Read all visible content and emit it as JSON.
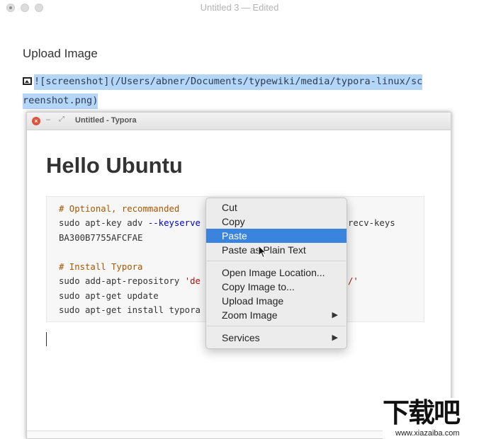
{
  "window": {
    "title": "Untitled 3",
    "title_separator": "—",
    "title_status": "Edited"
  },
  "document": {
    "heading": "Upload Image",
    "markdown_line1": "![screenshot](/Users/abner/Documents/typewiki/media/typora-linux/sc",
    "markdown_line2": "reenshot.png)"
  },
  "screenshot": {
    "window_title": "Untitled - Typora",
    "heading": "Hello Ubuntu",
    "code": {
      "line1": "# Optional, recommanded",
      "line2_a": "sudo apt-key adv ",
      "line2_b": "--keyserve",
      "line2_c": "recv-keys",
      "line3": "BA300B7755AFCFAE",
      "line5": "# Install Typora",
      "line6_a": "sudo add-apt-repository ",
      "line6_b": "'de",
      "line6_c": "/'",
      "line7": "sudo apt-get update",
      "line8": "sudo apt-get install typora"
    }
  },
  "context_menu": {
    "items": [
      {
        "label": "Cut"
      },
      {
        "label": "Copy"
      },
      {
        "label": "Paste"
      },
      {
        "label": "Paste as Plain Text"
      },
      {
        "label": "Open Image Location..."
      },
      {
        "label": "Copy Image to..."
      },
      {
        "label": "Upload Image"
      },
      {
        "label": "Zoom Image"
      },
      {
        "label": "Services"
      }
    ],
    "submenu_arrow": "▶",
    "active_item": "Paste"
  },
  "watermark": {
    "logo_text": "下载吧",
    "url": "www.xiazaiba.com"
  },
  "colors": {
    "selection": "#b6d6f7",
    "menu_highlight": "#3a84de",
    "close_button": "#e0513a"
  }
}
